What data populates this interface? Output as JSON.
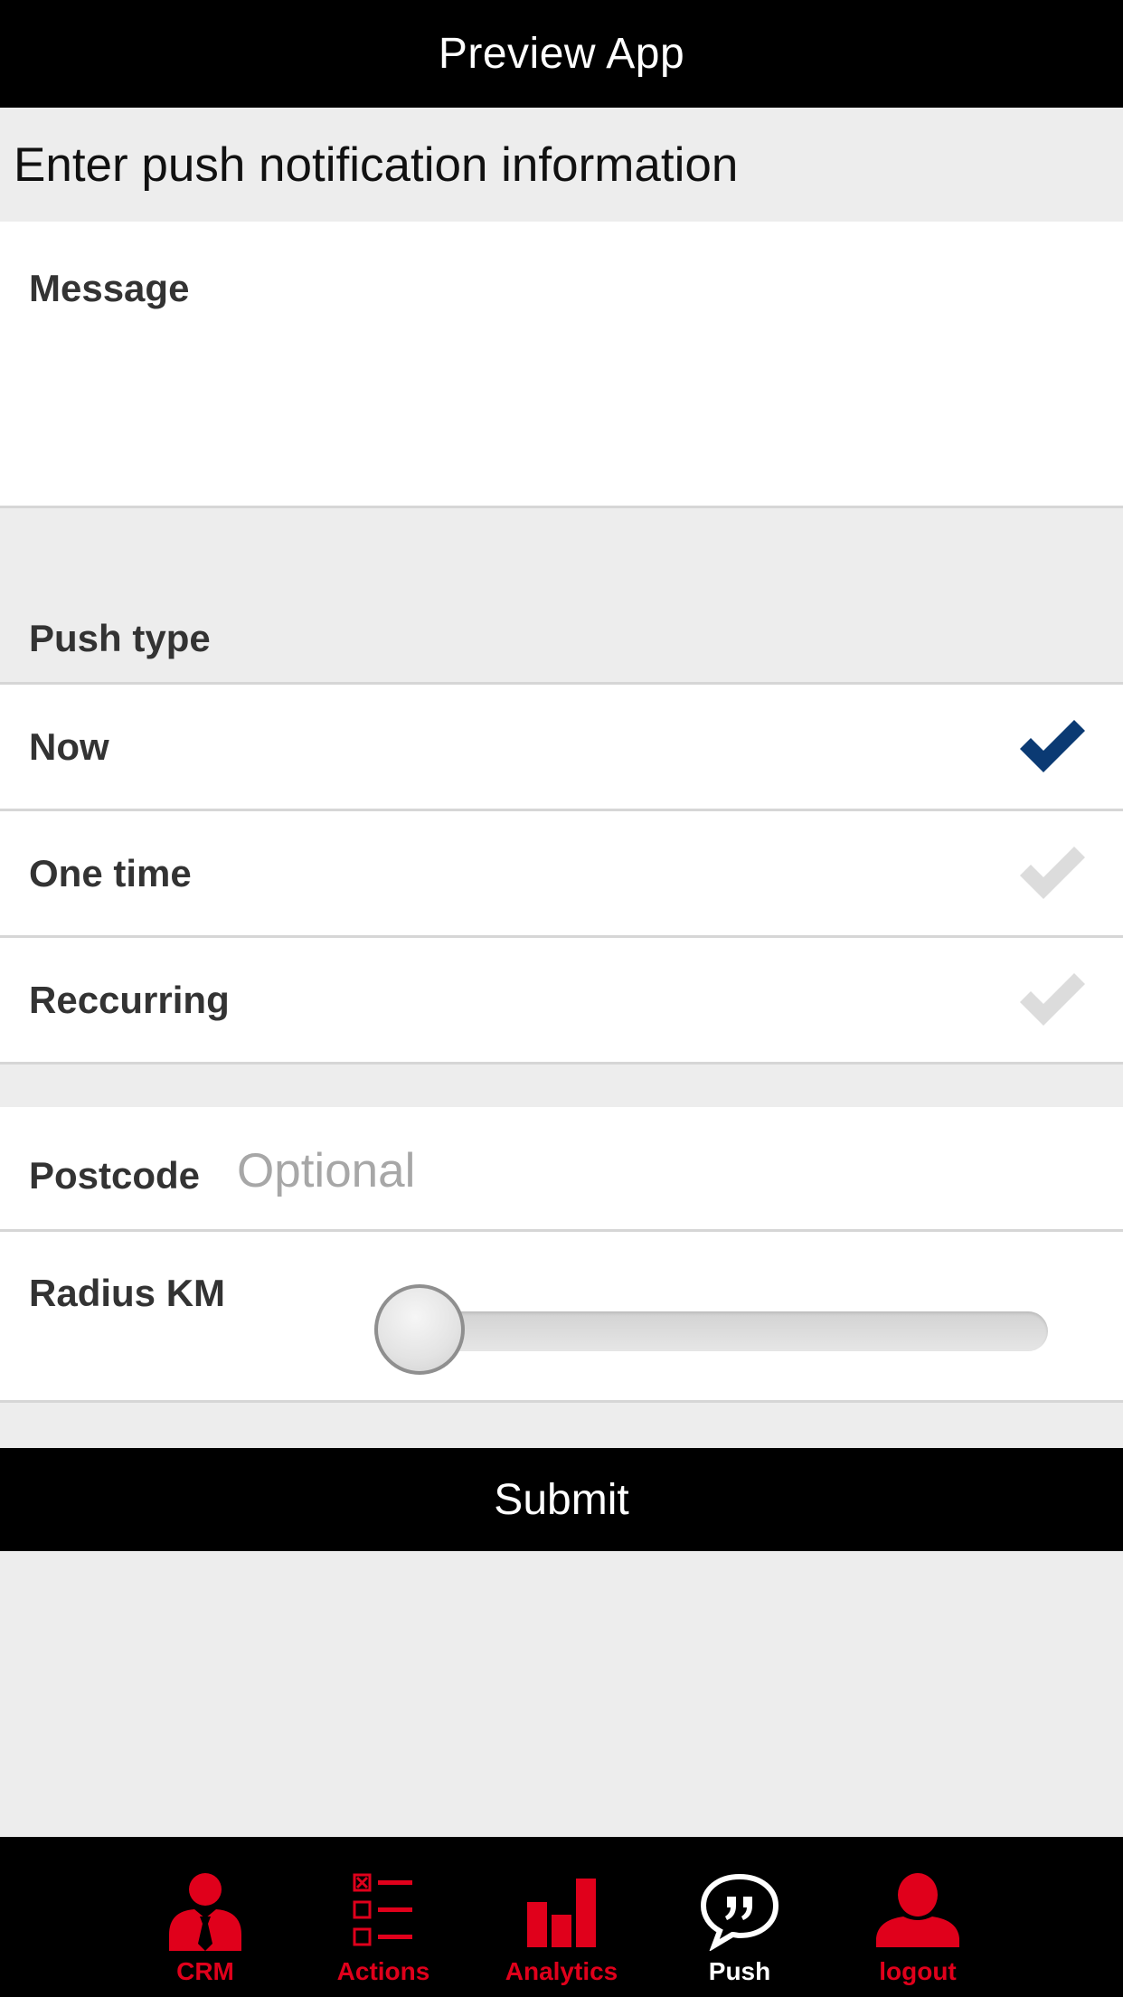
{
  "header": {
    "title": "Preview App"
  },
  "form": {
    "heading": "Enter push notification information",
    "message_label": "Message",
    "message_value": "",
    "push_type_label": "Push type",
    "push_types": [
      {
        "label": "Now",
        "selected": true
      },
      {
        "label": "One time",
        "selected": false
      },
      {
        "label": "Reccurring",
        "selected": false
      }
    ],
    "postcode_label": "Postcode",
    "postcode_placeholder": "Optional",
    "postcode_value": "",
    "radius_label": "Radius KM",
    "radius_value": 0,
    "submit_label": "Submit"
  },
  "tabs": [
    {
      "label": "CRM",
      "icon": "person-tie-icon",
      "active": false
    },
    {
      "label": "Actions",
      "icon": "checklist-icon",
      "active": false
    },
    {
      "label": "Analytics",
      "icon": "bar-chart-icon",
      "active": false
    },
    {
      "label": "Push",
      "icon": "speech-bubble-quote-icon",
      "active": true
    },
    {
      "label": "logout",
      "icon": "person-icon",
      "active": false
    }
  ],
  "colors": {
    "check_selected": "#0b3a73",
    "check_unselected": "#dcdcdc",
    "tab_inactive": "#e0001b",
    "tab_active": "#ffffff",
    "bar_background": "#000000"
  }
}
